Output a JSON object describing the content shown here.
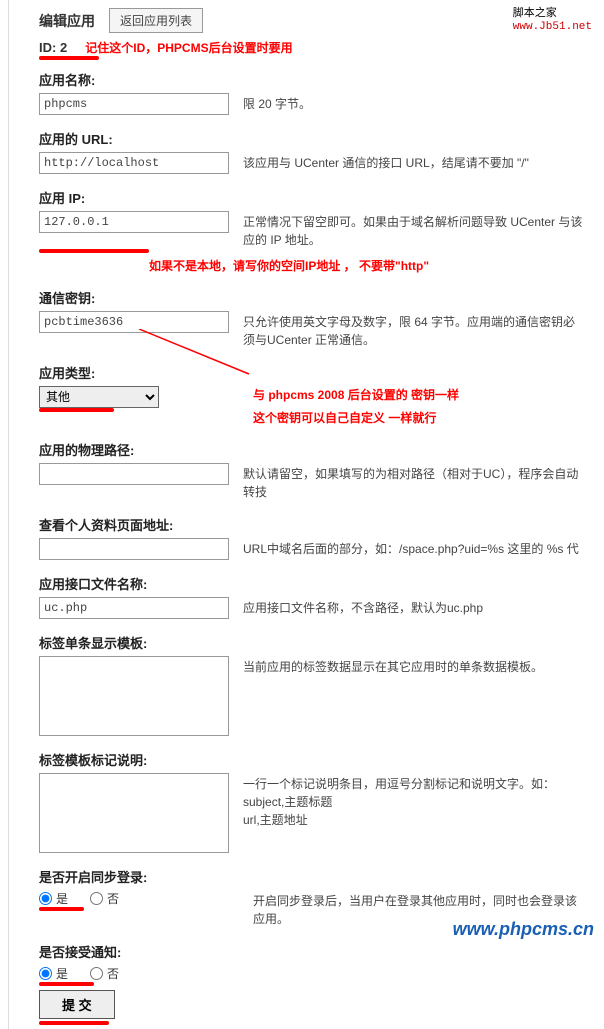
{
  "header": {
    "title": "编辑应用",
    "back_btn": "返回应用列表",
    "brand_line1": "脚本之家",
    "brand_line2": "www.Jb51.net"
  },
  "id_section": {
    "label": "ID: 2",
    "note": "记住这个ID，PHPCMS后台设置时要用"
  },
  "fields": {
    "app_name": {
      "label": "应用名称:",
      "value": "phpcms",
      "help": "限 20 字节。"
    },
    "app_url": {
      "label": "应用的 URL:",
      "value": "http://localhost",
      "help": "该应用与 UCenter 通信的接口 URL，结尾请不要加 \"/\""
    },
    "app_ip": {
      "label": "应用 IP:",
      "value": "127.0.0.1",
      "help": "正常情况下留空即可。如果由于域名解析问题导致 UCenter 与该应的 IP 地址。",
      "note": "如果不是本地，请写你的空间IP地址   ，    不要带\"http\""
    },
    "secret": {
      "label": "通信密钥:",
      "value": "pcbtime3636",
      "help": "只允许使用英文字母及数字，限 64 字节。应用端的通信密钥必须与UCenter 正常通信。",
      "note1": "与  phpcms 2008   后台设置的   密钥一样",
      "note2": "这个密钥可以自己自定义   一样就行"
    },
    "app_type": {
      "label": "应用类型:",
      "value": "其他"
    },
    "phys_path": {
      "label": "应用的物理路径:",
      "value": "",
      "help": "默认请留空，如果填写的为相对路径（相对于UC），程序会自动转技"
    },
    "profile_url": {
      "label": "查看个人资料页面地址:",
      "value": "",
      "help": "URL中域名后面的部分，如：/space.php?uid=%s 这里的 %s 代"
    },
    "api_file": {
      "label": "应用接口文件名称:",
      "value": "uc.php",
      "help": "应用接口文件名称，不含路径，默认为uc.php"
    },
    "tag_tpl": {
      "label": "标签单条显示模板:",
      "value": "",
      "help": "当前应用的标签数据显示在其它应用时的单条数据模板。"
    },
    "tag_desc": {
      "label": "标签模板标记说明:",
      "value": "",
      "help": "一行一个标记说明条目，用逗号分割标记和说明文字。如：\nsubject,主题标题\nurl,主题地址"
    },
    "sync_login": {
      "label": "是否开启同步登录:",
      "yes": "是",
      "no": "否",
      "help": "开启同步登录后，当用户在登录其他应用时，同时也会登录该应用。"
    },
    "recv_notify": {
      "label": "是否接受通知:",
      "yes": "是",
      "no": "否"
    }
  },
  "submit": "提 交",
  "footer_url": "www.phpcms.cn"
}
